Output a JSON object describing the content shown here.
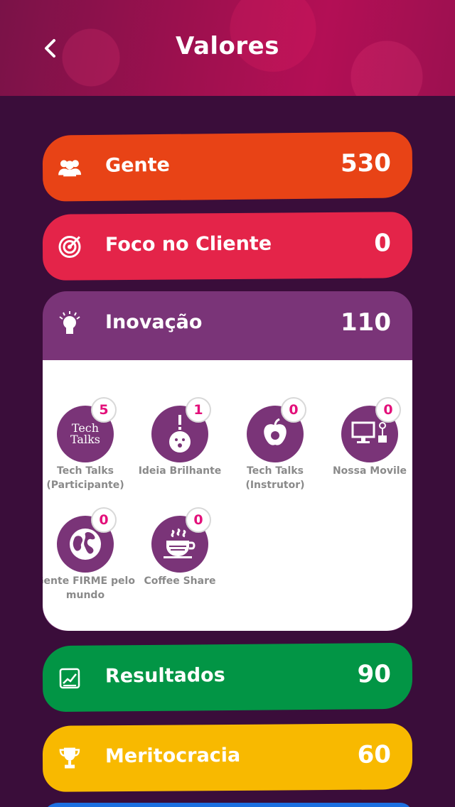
{
  "header": {
    "title": "Valores"
  },
  "values": {
    "gente": {
      "name": "Gente",
      "score": "530",
      "icon": "users-icon",
      "color": "#e84316"
    },
    "foco": {
      "name": "Foco no Cliente",
      "score": "0",
      "icon": "target-icon",
      "color": "#e42449"
    },
    "inovacao": {
      "name": "Inovação",
      "score": "110",
      "icon": "lightbulb-icon",
      "color": "#7a3478",
      "badges": [
        {
          "label": "Tech Talks (Participante)",
          "count": "5",
          "icon": "tech-talks-icon",
          "icon_text": [
            "Tech",
            "Talks"
          ]
        },
        {
          "label": "Ideia Brilhante",
          "count": "1",
          "icon": "bright-idea-icon"
        },
        {
          "label": "Tech Talks (Instrutor)",
          "count": "0",
          "icon": "apple-icon"
        },
        {
          "label": "Nossa Movile",
          "count": "0",
          "icon": "workstation-icon"
        },
        {
          "label": "Gente FIRME pelo mundo",
          "count": "0",
          "icon": "globe-icon"
        },
        {
          "label": "Coffee Share",
          "count": "0",
          "icon": "coffee-cup-icon"
        }
      ]
    },
    "resultados": {
      "name": "Resultados",
      "score": "90",
      "icon": "chart-icon",
      "color": "#029545"
    },
    "meritocracia": {
      "name": "Meritocracia",
      "score": "60",
      "icon": "trophy-icon",
      "color": "#f8b900"
    }
  }
}
